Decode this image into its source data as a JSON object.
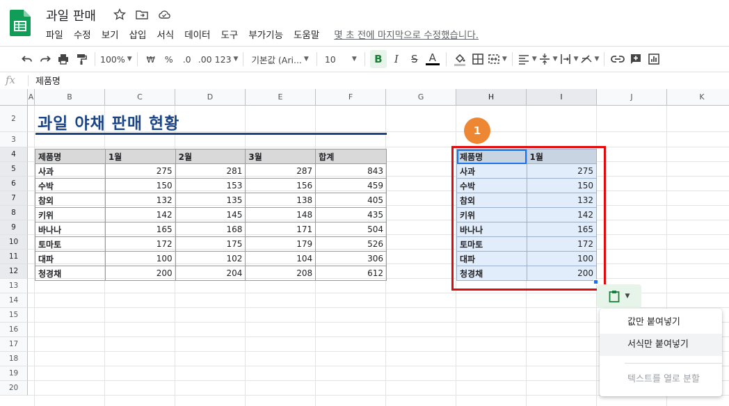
{
  "doc": {
    "title": "과일 판매",
    "menu": [
      "파일",
      "수정",
      "보기",
      "삽입",
      "서식",
      "데이터",
      "도구",
      "부가기능",
      "도움말"
    ],
    "last_edit": "몇 초 전에 마지막으로 수정했습니다."
  },
  "toolbar": {
    "zoom": "100%",
    "currency": "₩",
    "percent": "%",
    "dec_decrease": ".0",
    "dec_increase": ".00",
    "more_formats": "123",
    "font": "기본값 (Ari...",
    "font_size": "10",
    "bold": "B",
    "italic": "I",
    "strike": "S",
    "text_color": "A"
  },
  "formula_bar": {
    "fx": "fx",
    "value": "제품명"
  },
  "columns": [
    "A",
    "B",
    "C",
    "D",
    "E",
    "F",
    "G",
    "H",
    "I",
    "J",
    "K"
  ],
  "rows": [
    "2",
    "3",
    "4",
    "5",
    "6",
    "7",
    "8",
    "9",
    "10",
    "11",
    "12",
    "13",
    "14",
    "15",
    "16",
    "17",
    "18",
    "19",
    "20"
  ],
  "sheet": {
    "heading": "과일 야채 판매 현황",
    "headers": [
      "제품명",
      "1월",
      "2월",
      "3월",
      "합계"
    ],
    "rows": [
      [
        "사과",
        "275",
        "281",
        "287",
        "843"
      ],
      [
        "수박",
        "150",
        "153",
        "156",
        "459"
      ],
      [
        "참외",
        "132",
        "135",
        "138",
        "405"
      ],
      [
        "키위",
        "142",
        "145",
        "148",
        "435"
      ],
      [
        "바나나",
        "165",
        "168",
        "171",
        "504"
      ],
      [
        "토마토",
        "172",
        "175",
        "179",
        "526"
      ],
      [
        "대파",
        "100",
        "102",
        "104",
        "306"
      ],
      [
        "청경채",
        "200",
        "204",
        "208",
        "612"
      ]
    ]
  },
  "pasted": {
    "headers": [
      "제품명",
      "1월"
    ],
    "rows": [
      [
        "사과",
        "275"
      ],
      [
        "수박",
        "150"
      ],
      [
        "참외",
        "132"
      ],
      [
        "키위",
        "142"
      ],
      [
        "바나나",
        "165"
      ],
      [
        "토마토",
        "172"
      ],
      [
        "대파",
        "100"
      ],
      [
        "청경채",
        "200"
      ]
    ]
  },
  "callout": "1",
  "paste_menu": {
    "items": [
      "값만 붙여넣기",
      "서식만 붙여넣기",
      "텍스트를 열로 분할"
    ]
  },
  "colors": {
    "heading": "#1c4587",
    "highlight_box": "#e0090b",
    "badge": "#ee8733",
    "selection": "#1a73e8"
  }
}
